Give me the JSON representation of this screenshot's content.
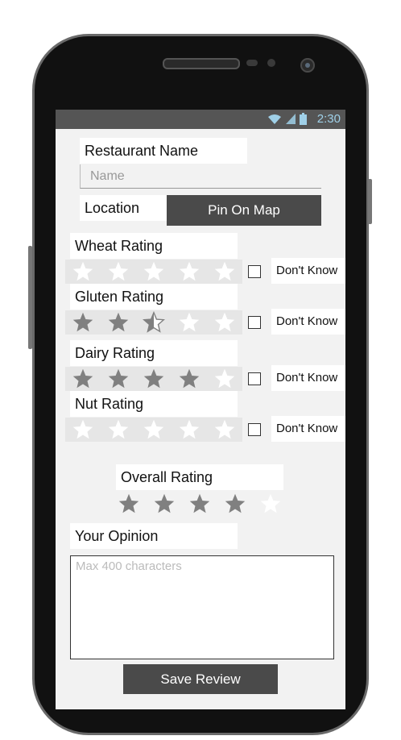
{
  "status_bar": {
    "time": "2:30"
  },
  "restaurant": {
    "label": "Restaurant Name",
    "placeholder": "Name",
    "value": ""
  },
  "location": {
    "label": "Location",
    "pin_button": "Pin On Map"
  },
  "ratings": [
    {
      "label": "Wheat Rating",
      "stars": 0,
      "dont_know": "Don't Know",
      "dont_know_checked": false
    },
    {
      "label": "Gluten Rating",
      "stars": 2.5,
      "dont_know": "Don't Know",
      "dont_know_checked": false
    },
    {
      "label": "Dairy Rating",
      "stars": 4,
      "dont_know": "Don't Know",
      "dont_know_checked": false
    },
    {
      "label": "Nut Rating",
      "stars": 0,
      "dont_know": "Don't Know",
      "dont_know_checked": false
    }
  ],
  "overall": {
    "label": "Overall Rating",
    "stars": 4
  },
  "opinion": {
    "label": "Your Opinion",
    "placeholder": "Max 400 characters",
    "value": ""
  },
  "save_button": "Save Review",
  "colors": {
    "star_filled": "#808080",
    "star_empty": "#ffffff",
    "button": "#4a4a4a",
    "status_bar": "#555555",
    "status_text": "#9fd0e8"
  }
}
